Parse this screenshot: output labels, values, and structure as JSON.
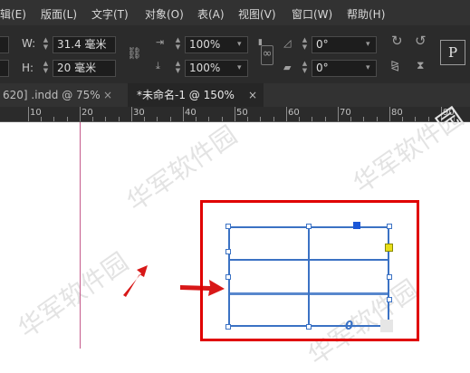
{
  "menu": {
    "items": [
      "编辑(E)",
      "版面(L)",
      "文字(T)",
      "对象(O)",
      "表(A)",
      "视图(V)",
      "窗口(W)",
      "帮助(H)"
    ],
    "first_visible": "辑(E)"
  },
  "control_panel": {
    "w_label": "W:",
    "w_value": "31.4 毫米",
    "h_label": "H:",
    "h_value": "20 毫米",
    "scale_x": "100%",
    "scale_y": "100%",
    "rotate": "0°",
    "shear": "0°",
    "ref_point_label": "P"
  },
  "tabs": {
    "inactive_label": "620] .indd @ 75%",
    "active_label": "*未命名-1 @ 150%",
    "close_glyph": "×"
  },
  "ruler": {
    "labels": [
      "10",
      "20",
      "30",
      "40",
      "50",
      "60",
      "70",
      "80",
      "90"
    ]
  },
  "canvas": {
    "watermark": "华军软件园",
    "overset_marker": "0-",
    "colors": {
      "highlight_box": "#e00000",
      "arrow": "#d81818",
      "frame": "#3b72c4",
      "table_lines": "#3b72c4",
      "overset": "#f4e000"
    }
  }
}
